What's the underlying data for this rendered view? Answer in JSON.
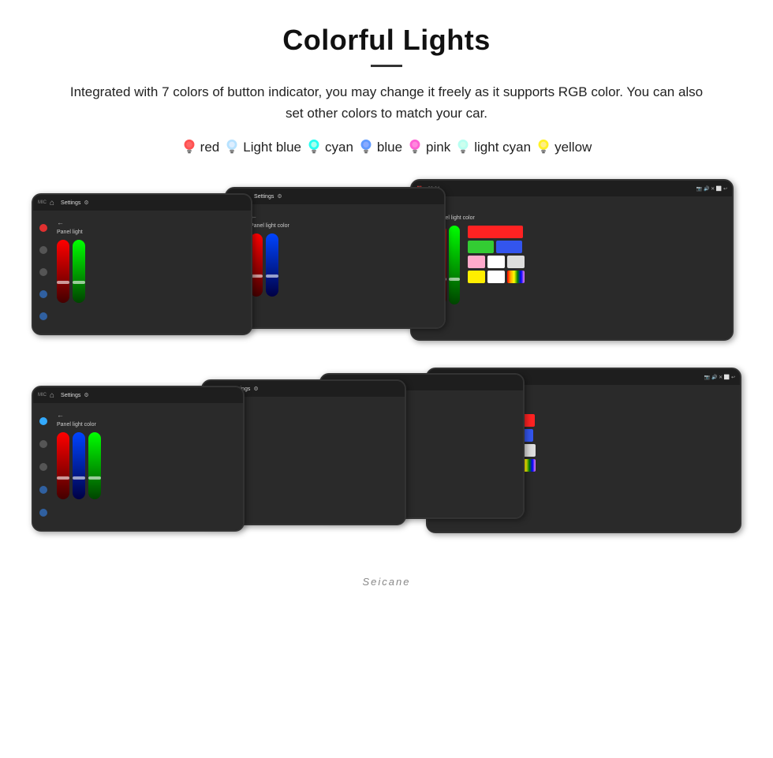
{
  "title": "Colorful Lights",
  "description": "Integrated with 7 colors of button indicator, you may change it freely as it supports RGB color. You can also set other colors to match your car.",
  "colors": [
    {
      "name": "red",
      "bulbColor": "#ff3333",
      "glowColor": "#ff6666"
    },
    {
      "name": "Light blue",
      "bulbColor": "#aaddff",
      "glowColor": "#cceeff"
    },
    {
      "name": "cyan",
      "bulbColor": "#00ffee",
      "glowColor": "#aaffee"
    },
    {
      "name": "blue",
      "bulbColor": "#4488ff",
      "glowColor": "#88aaff"
    },
    {
      "name": "pink",
      "bulbColor": "#ff44cc",
      "glowColor": "#ff88dd"
    },
    {
      "name": "light cyan",
      "bulbColor": "#aaffee",
      "glowColor": "#ccffee"
    },
    {
      "name": "yellow",
      "bulbColor": "#ffee00",
      "glowColor": "#ffee88"
    }
  ],
  "watermark": "Seicane",
  "screen": {
    "settings_label": "Settings",
    "panel_label": "Panel light color",
    "back_label": "←"
  },
  "palette_colors": {
    "row1": [
      "#ff0000",
      "#00cc00",
      "#2244ff"
    ],
    "row2": [
      "#ffcccc",
      "#00ee44",
      "#4466ff"
    ],
    "row3": [
      "#ffaacc",
      "#ffffff",
      "#ffffff"
    ],
    "row4": [
      "#ffee00",
      "#ffffff",
      "rainbow"
    ]
  }
}
